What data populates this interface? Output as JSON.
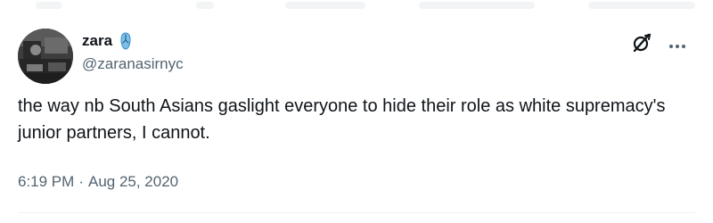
{
  "user": {
    "display_name": "zara",
    "handle": "@zaranasirnyc",
    "name_emoji": "flip-flop-icon"
  },
  "tweet": {
    "text": "the way nb South Asians gaslight everyone to hide their role as white supremacy's junior partners, I cannot.",
    "time": "6:19 PM",
    "separator": "·",
    "date": "Aug 25, 2020"
  },
  "actions": {
    "grok_icon": "grok-icon",
    "more_icon": "more-icon"
  },
  "colors": {
    "text_primary": "#0f1419",
    "text_secondary": "#536471",
    "divider": "#eff3f4",
    "flipflop": "#4aa3df"
  }
}
